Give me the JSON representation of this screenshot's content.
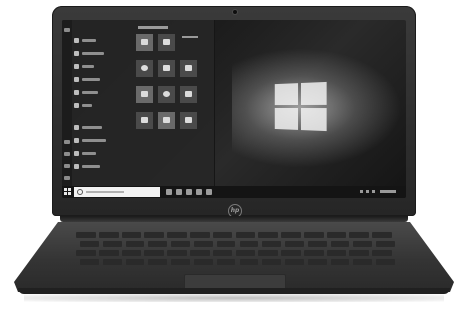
{
  "device": {
    "brand_mark": "hp",
    "os_logo_icon": "windows-logo-icon"
  },
  "start_menu": {
    "tiles_header_icon": "tiles-header-icon"
  },
  "taskbar": {
    "start_icon": "windows-start-icon",
    "search_icon": "search-icon"
  }
}
